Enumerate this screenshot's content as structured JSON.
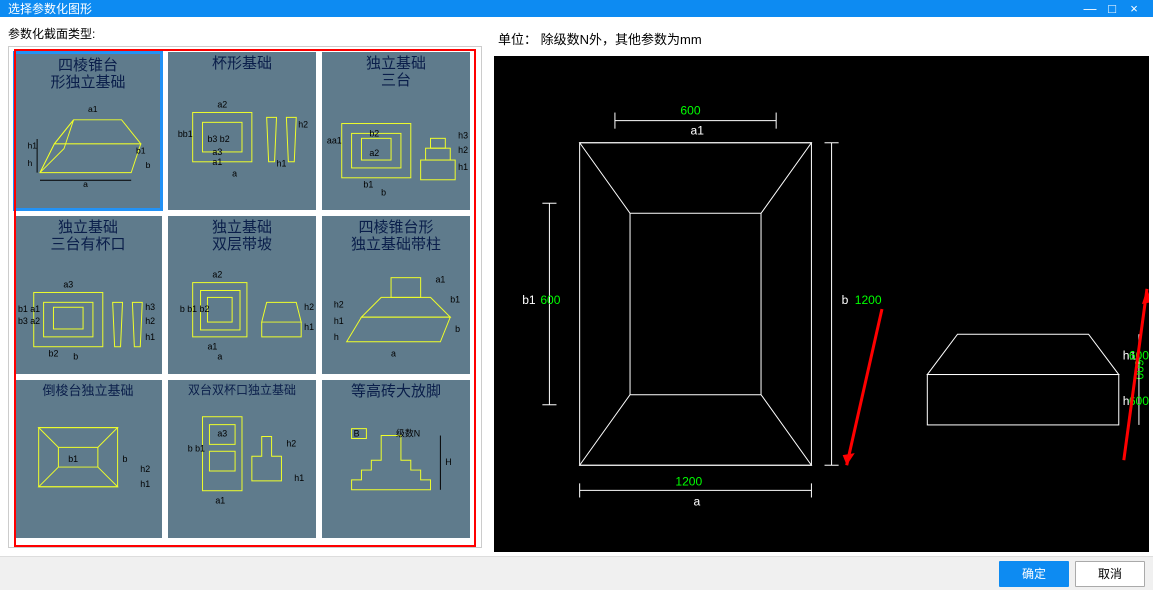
{
  "window": {
    "title": "选择参数化图形",
    "minimize": "—",
    "maximize": "□",
    "close": "×"
  },
  "left": {
    "section_label": "参数化截面类型:",
    "shapes": [
      {
        "title": "四棱锥台\n形独立基础",
        "selected": true
      },
      {
        "title": "杯形基础",
        "selected": false
      },
      {
        "title": "独立基础\n三台",
        "selected": false
      },
      {
        "title": "独立基础\n三台有杯口",
        "selected": false
      },
      {
        "title": "独立基础\n双层带坡",
        "selected": false
      },
      {
        "title": "四棱锥台形\n独立基础带柱",
        "selected": false
      },
      {
        "title": "倒梭台独立基础",
        "selected": false
      },
      {
        "title": "双台双杯口独立基础",
        "selected": false
      },
      {
        "title": "等高砖大放脚",
        "selected": false
      }
    ],
    "thumb_labels": {
      "a": "a",
      "b": "b",
      "a1": "a1",
      "a2": "a2",
      "a3": "a3",
      "b1": "b1",
      "b2": "b2",
      "b3": "b3",
      "h": "h",
      "h1": "h1",
      "h2": "h2",
      "h3": "h3",
      "B": "B",
      "H": "H",
      "N": "级数N"
    }
  },
  "right": {
    "unit_label": "单位： 除级数N外，其他参数为mm",
    "params": {
      "a": {
        "label": "a",
        "value": "1200"
      },
      "b": {
        "label": "b",
        "value": "1200"
      },
      "a1": {
        "label": "a1",
        "value": "600"
      },
      "b1": {
        "label": "b1",
        "value": "600"
      },
      "h": {
        "label": "h",
        "value": "600"
      },
      "h1": {
        "label": "h1",
        "value": "600"
      }
    }
  },
  "footer": {
    "ok": "确定",
    "cancel": "取消"
  }
}
